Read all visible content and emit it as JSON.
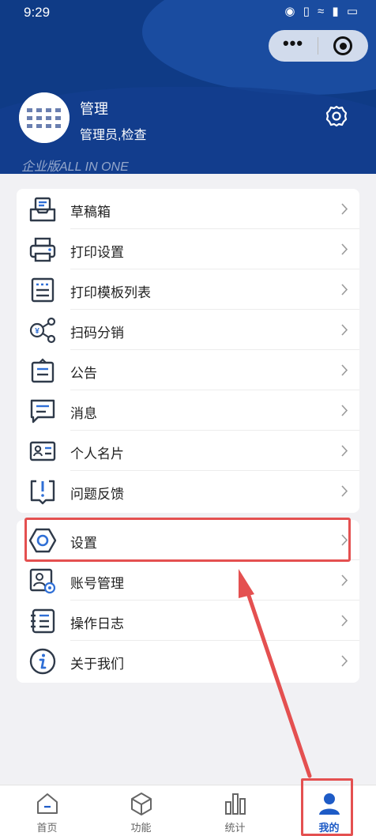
{
  "status_bar": {
    "time": "9:29",
    "icons": "◉ ▯ ≈ ▮ ▭"
  },
  "user": {
    "name": "管理",
    "role": "管理员,检查"
  },
  "edition": "企业版ALL IN ONE",
  "menu_group_1": [
    {
      "label": "草稿箱",
      "icon": "draft-box-icon"
    },
    {
      "label": "打印设置",
      "icon": "printer-icon"
    },
    {
      "label": "打印模板列表",
      "icon": "template-list-icon"
    },
    {
      "label": "扫码分销",
      "icon": "share-yen-icon"
    },
    {
      "label": "公告",
      "icon": "notice-icon"
    },
    {
      "label": "消息",
      "icon": "message-icon"
    },
    {
      "label": "个人名片",
      "icon": "business-card-icon"
    },
    {
      "label": "问题反馈",
      "icon": "feedback-icon"
    }
  ],
  "menu_group_2": [
    {
      "label": "设置",
      "icon": "settings-hexagon-icon"
    },
    {
      "label": "账号管理",
      "icon": "account-manage-icon"
    },
    {
      "label": "操作日志",
      "icon": "log-icon"
    },
    {
      "label": "关于我们",
      "icon": "info-icon"
    }
  ],
  "tabs": [
    {
      "label": "首页",
      "icon": "home-icon"
    },
    {
      "label": "功能",
      "icon": "cube-icon"
    },
    {
      "label": "统计",
      "icon": "bar-chart-icon"
    },
    {
      "label": "我的",
      "icon": "person-icon"
    }
  ],
  "active_tab": "我的",
  "colors": {
    "header": "#0f3b86",
    "accent": "#1e5bc6",
    "highlight": "#e45050",
    "icon": "#2f3a4a"
  }
}
